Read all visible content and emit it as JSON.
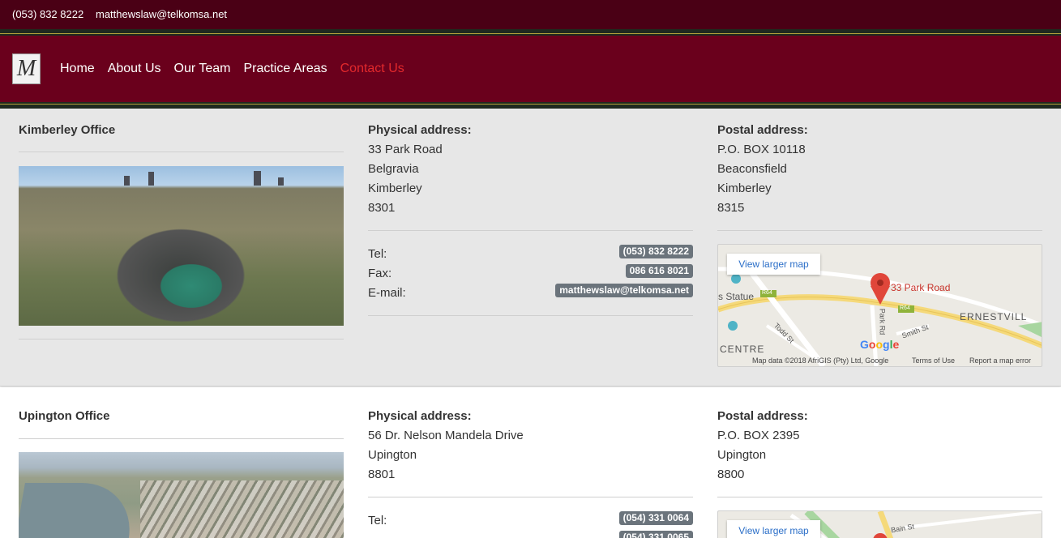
{
  "topbar": {
    "phone": "(053) 832 8222",
    "email": "matthewslaw@telkomsa.net"
  },
  "nav": {
    "logo_letter": "M",
    "items": [
      {
        "label": "Home",
        "active": false
      },
      {
        "label": "About Us",
        "active": false
      },
      {
        "label": "Our Team",
        "active": false
      },
      {
        "label": "Practice Areas",
        "active": false
      },
      {
        "label": "Contact Us",
        "active": true
      }
    ]
  },
  "offices": [
    {
      "name": "Kimberley Office",
      "physical_heading": "Physical address:",
      "physical": [
        "33 Park Road",
        "Belgravia",
        "Kimberley",
        "8301"
      ],
      "postal_heading": "Postal address:",
      "postal": [
        "P.O. BOX 10118",
        "Beaconsfield",
        "Kimberley",
        "8315"
      ],
      "tel_label": "Tel:",
      "tel": "(053) 832 8222",
      "fax_label": "Fax:",
      "fax": "086 616 8021",
      "email_label": "E-mail:",
      "email": "matthewslaw@telkomsa.net",
      "map": {
        "button": "View larger map",
        "pin_label": "33 Park Road",
        "labels": [
          "s Statue",
          "ERNESTVILL",
          "CENTRE",
          "Park Rd",
          "Todd St",
          "Smith St",
          "R64",
          "R64"
        ],
        "footer_data": "Map data ©2018 AfriGIS (Pty) Ltd, Google",
        "footer_terms": "Terms of Use",
        "footer_report": "Report a map error"
      }
    },
    {
      "name": "Upington Office",
      "physical_heading": "Physical address:",
      "physical": [
        "56 Dr. Nelson Mandela Drive",
        "Upington",
        "8801"
      ],
      "postal_heading": "Postal address:",
      "postal": [
        "P.O. BOX 2395",
        "Upington",
        "8800"
      ],
      "tel_label": "Tel:",
      "tel": "(054) 331 0064",
      "fax_partial": "(054) 331 0065",
      "map": {
        "button": "View larger map",
        "street": "Bain St"
      }
    }
  ],
  "colors": {
    "topbar": "#4a0015",
    "nav": "#6a001c",
    "active": "#e2282c",
    "badge": "#6b747c"
  }
}
